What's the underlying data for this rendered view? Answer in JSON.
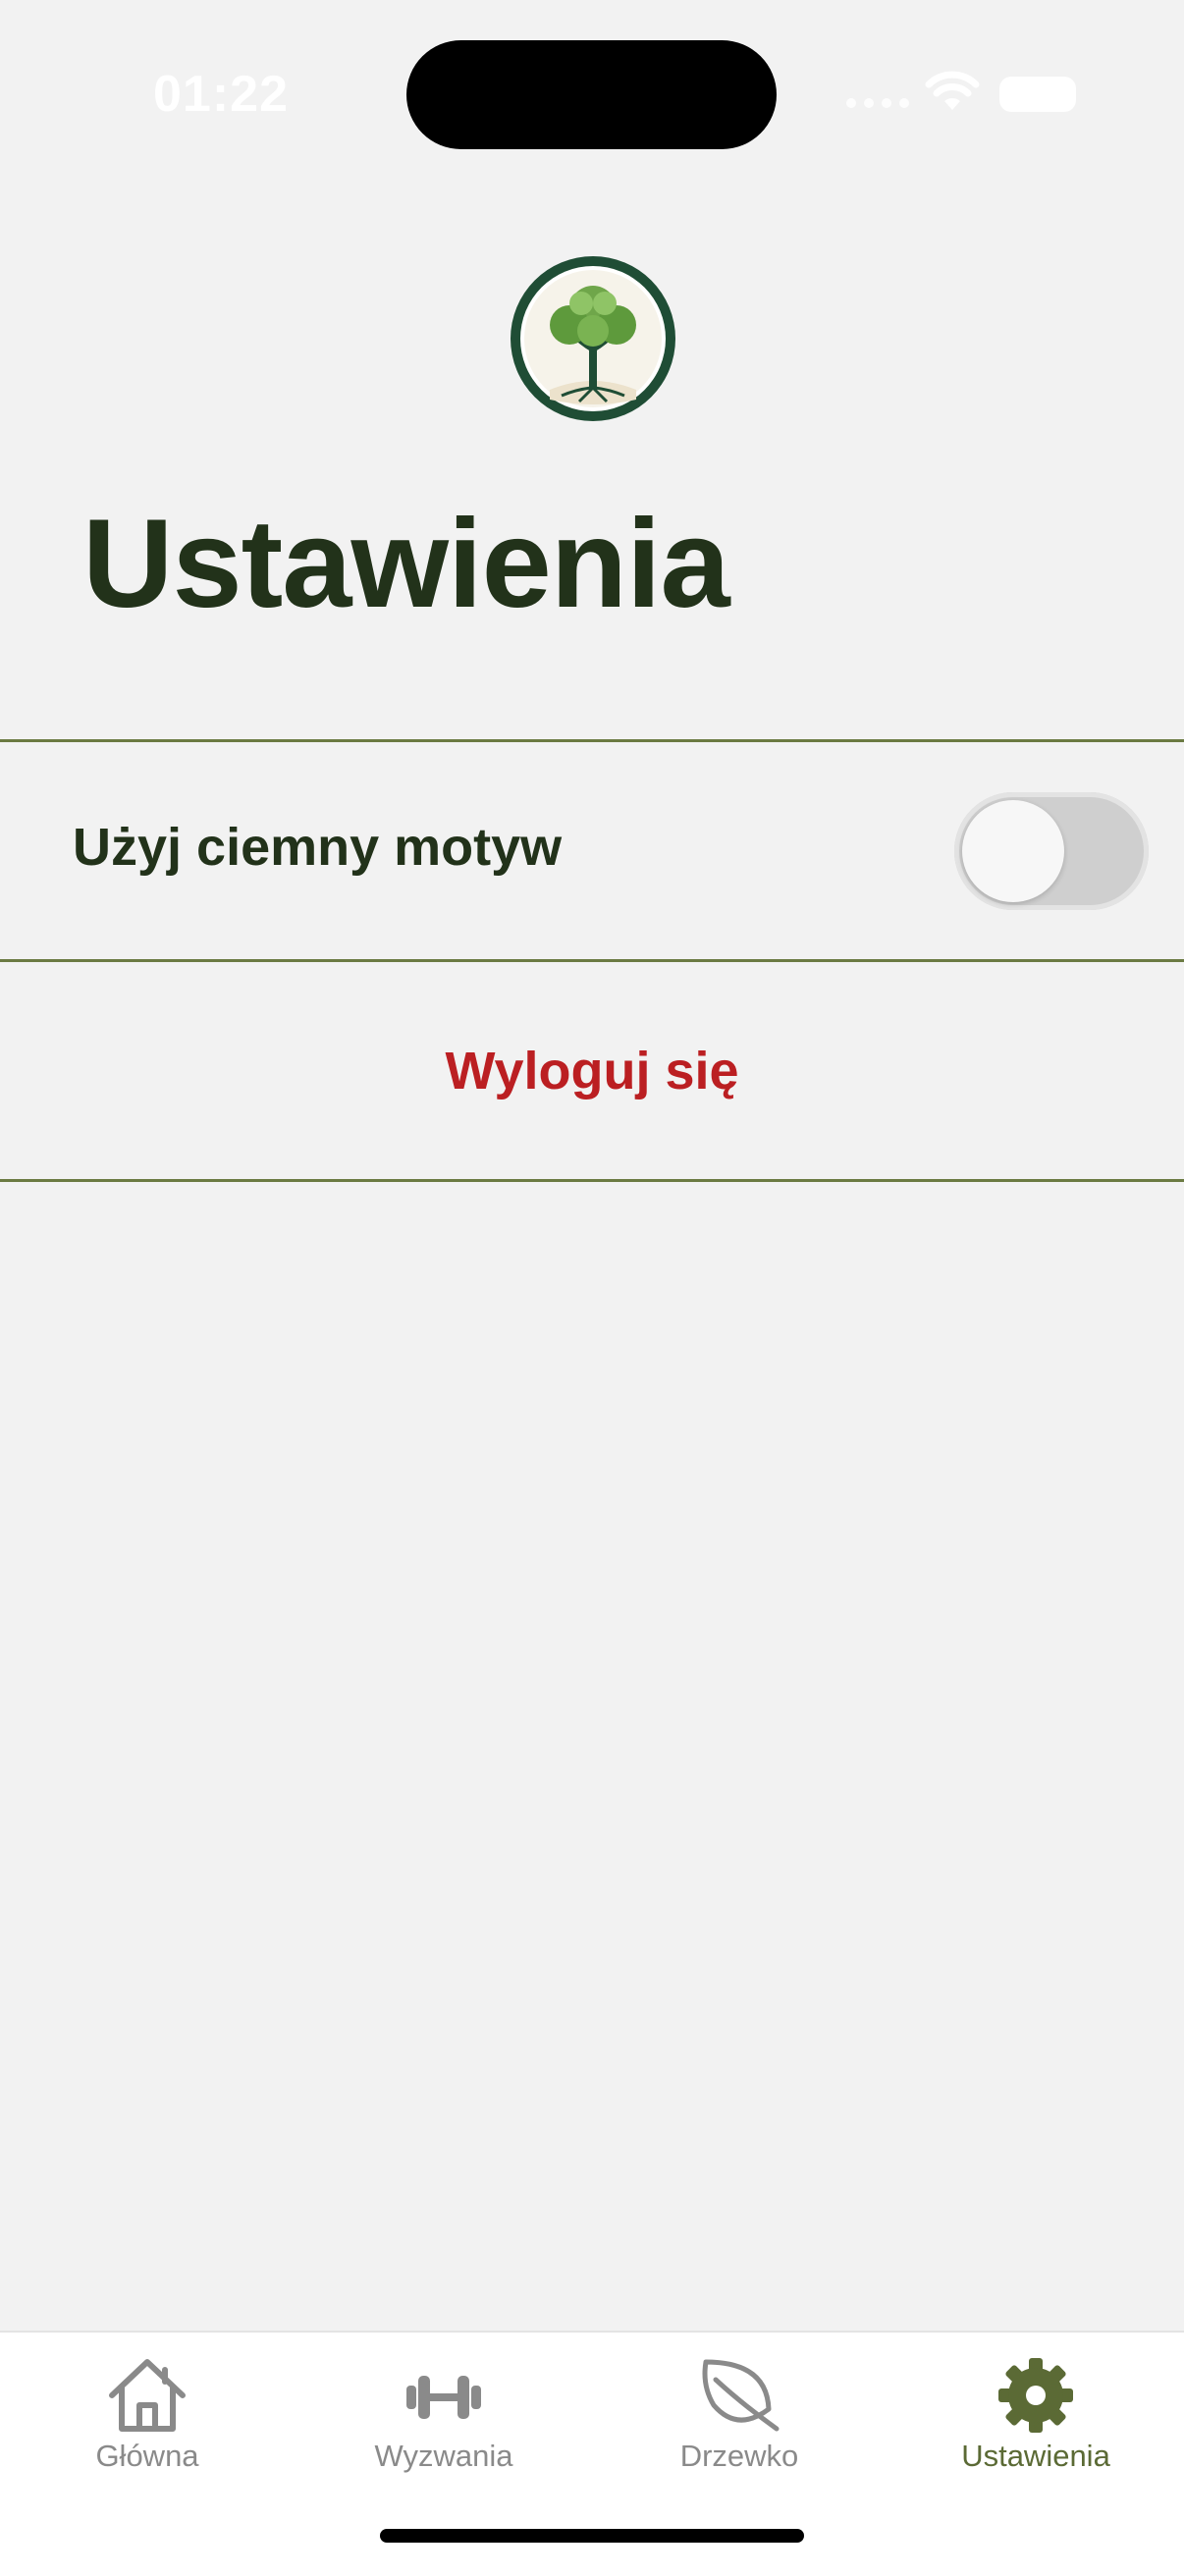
{
  "status_bar": {
    "time": "01:22"
  },
  "page": {
    "title": "Ustawienia"
  },
  "settings": {
    "dark_mode_label": "Użyj ciemny motyw",
    "dark_mode_enabled": false,
    "logout_label": "Wyloguj się"
  },
  "tab_bar": {
    "tabs": [
      {
        "label": "Główna",
        "icon": "home-icon",
        "active": false
      },
      {
        "label": "Wyzwania",
        "icon": "dumbbell-icon",
        "active": false
      },
      {
        "label": "Drzewko",
        "icon": "leaf-icon",
        "active": false
      },
      {
        "label": "Ustawienia",
        "icon": "gear-icon",
        "active": true
      }
    ]
  },
  "colors": {
    "background": "#f2f2f2",
    "title_text": "#22321a",
    "divider": "#6b7a42",
    "logout_red": "#bb1f22",
    "tab_active": "#5b6a35",
    "tab_inactive": "#8a8a8a"
  }
}
